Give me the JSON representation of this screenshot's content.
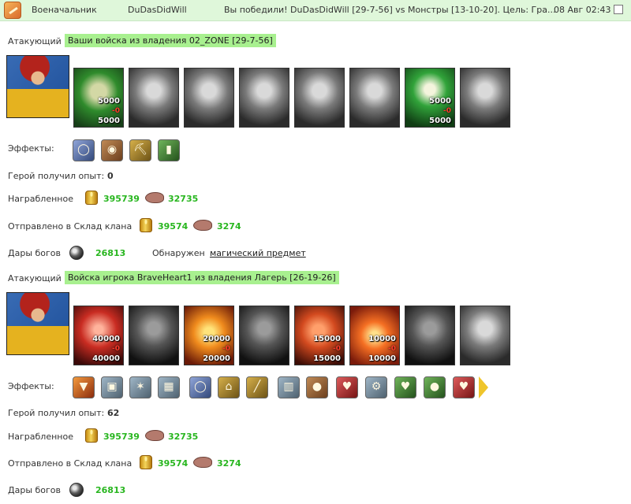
{
  "header": {
    "title_left": "Военачальник",
    "username": "DuDasDidWill",
    "battle_summary": "Вы победили! DuDasDidWill [29-7-56] vs Монстры [13-10-20]. Цель: Гра...",
    "datetime": "08 Авг 02:43",
    "checkbox_checked": false
  },
  "labels": {
    "attacker": "Атакующий",
    "effects": "Эффекты:",
    "experience": "Герой получил опыт:",
    "looted": "Награбленное",
    "sent_to_clan": "Отправлено в Склад клана",
    "gods_gifts": "Дары богов",
    "found": "Обнаружен",
    "found_item": "магический предмет"
  },
  "battles": [
    {
      "army_title": "Ваши войска из владения 02_ZONE [29-7-56]",
      "units": [
        {
          "icon": "green-hero-unit",
          "count1": "5000",
          "loss": "-0",
          "count2": "5000"
        },
        {
          "icon": "dark-knight-unit",
          "count1": "",
          "loss": "",
          "count2": ""
        },
        {
          "icon": "armored-soldier-unit",
          "count1": "",
          "loss": "",
          "count2": ""
        },
        {
          "icon": "griffin-unit",
          "count1": "",
          "loss": "",
          "count2": ""
        },
        {
          "icon": "winged-warrior-unit",
          "count1": "",
          "loss": "",
          "count2": ""
        },
        {
          "icon": "assassin-unit",
          "count1": "",
          "loss": "",
          "count2": ""
        },
        {
          "icon": "green-hooded-mage-unit",
          "count1": "5000",
          "loss": "-0",
          "count2": "5000"
        },
        {
          "icon": "robed-mage-unit",
          "count1": "",
          "loss": "",
          "count2": ""
        }
      ],
      "effects": [
        "ring-icon",
        "sack-icon",
        "pickaxe-icon",
        "scroll-icon"
      ],
      "experience": "0",
      "looted": {
        "gold": "395739",
        "ore": "32735"
      },
      "sent": {
        "gold": "39574",
        "ore": "3274"
      },
      "gods_gifts": "26813",
      "has_found": true
    },
    {
      "army_title": "Войска игрока BraveHeart1 из владения Лагерь [26-19-26]",
      "units": [
        {
          "icon": "red-dragon-unit",
          "count1": "40000",
          "loss": "-0",
          "count2": "40000"
        },
        {
          "icon": "dark-warrior-unit",
          "count1": "",
          "loss": "",
          "count2": ""
        },
        {
          "icon": "fire-beast-unit",
          "count1": "20000",
          "loss": "-0",
          "count2": "20000"
        },
        {
          "icon": "shadow-demon-unit",
          "count1": "",
          "loss": "",
          "count2": ""
        },
        {
          "icon": "lava-golem-unit",
          "count1": "15000",
          "loss": "-0",
          "count2": "15000"
        },
        {
          "icon": "fire-warrior-unit",
          "count1": "10000",
          "loss": "-0",
          "count2": "10000"
        },
        {
          "icon": "gray-horned-demon-unit",
          "count1": "",
          "loss": "",
          "count2": ""
        },
        {
          "icon": "cloaked-spirit-unit",
          "count1": "",
          "loss": "",
          "count2": ""
        }
      ],
      "effects": [
        "shield-icon",
        "armor-icon",
        "web-icon",
        "armor-plate-icon",
        "ring-icon",
        "gate-icon",
        "sword-icon",
        "grate-icon",
        "money-bag-icon",
        "heart-helmet-icon",
        "gears-icon",
        "green-heart-icon",
        "apple-icon",
        "heart-icon"
      ],
      "experience": "62",
      "looted": {
        "gold": "395739",
        "ore": "32735"
      },
      "sent": {
        "gold": "39574",
        "ore": "3274"
      },
      "gods_gifts": "26813",
      "has_found": false
    }
  ]
}
